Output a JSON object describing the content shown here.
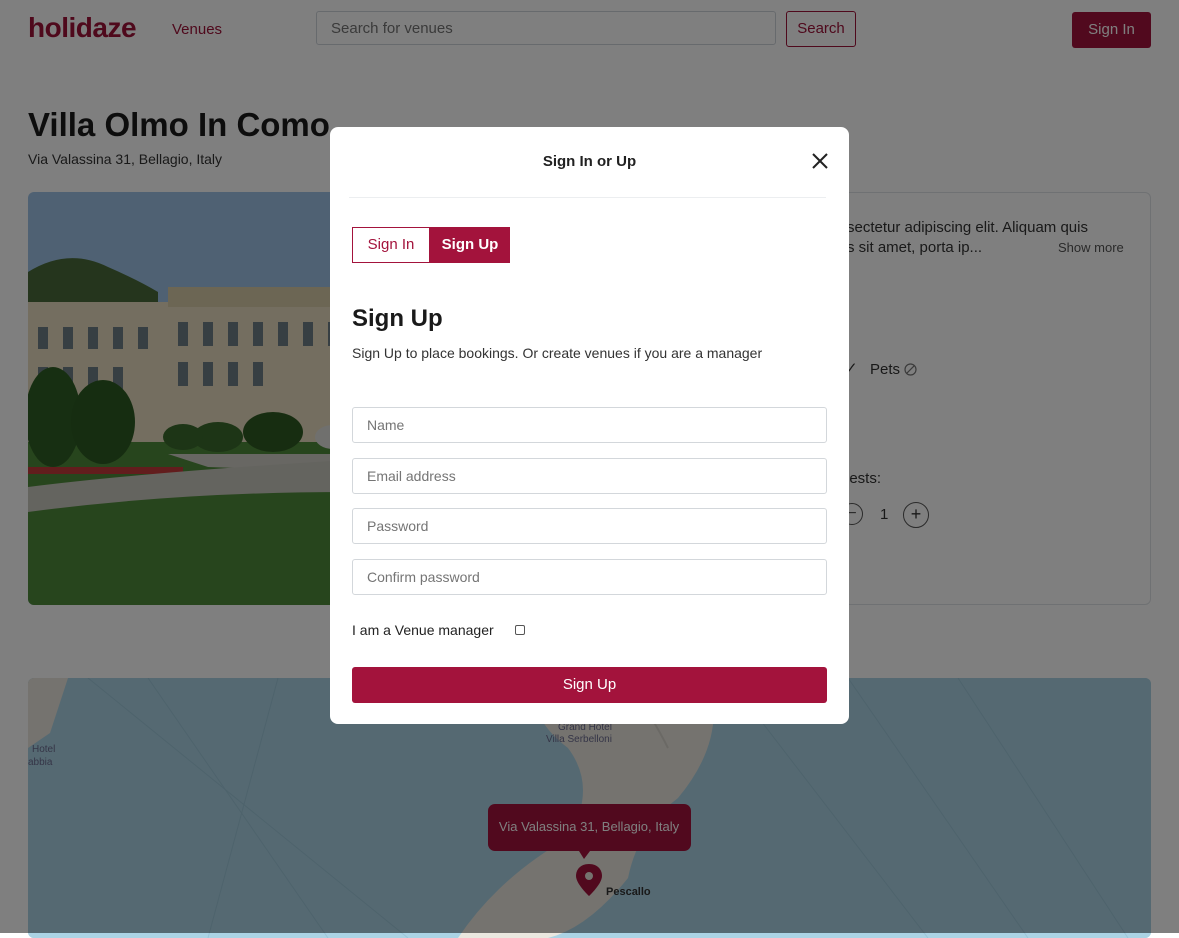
{
  "header": {
    "logo": "holidaze",
    "nav_venues": "Venues",
    "search_placeholder": "Search for venues",
    "search_button": "Search",
    "signin_button": "Sign In"
  },
  "venue": {
    "title": "Villa Olmo In Como",
    "address": "Via Valassina 31, Bellagio, Italy",
    "description_line1": "sectetur adipiscing elit. Aliquam quis",
    "description_line2": "s sit amet, porta ip...",
    "show_more": "Show more",
    "pets_label": "Pets",
    "guests_label": "uests:",
    "guest_count": "1",
    "minus": "−",
    "plus": "+"
  },
  "map": {
    "marker_address": "Via Valassina 31, Bellagio, Italy",
    "place_pescallo": "Pescallo",
    "place_grand_hotel": "Grand Hotel",
    "place_villa_serbelloni": "Villa Serbelloni",
    "place_hotel": "Hotel",
    "place_abbia": "abbia"
  },
  "modal": {
    "title": "Sign In or Up",
    "tab_signin": "Sign In",
    "tab_signup": "Sign Up",
    "form_title": "Sign Up",
    "form_subtitle": "Sign Up to place bookings. Or create venues if you are a manager",
    "name_placeholder": "Name",
    "email_placeholder": "Email address",
    "password_placeholder": "Password",
    "confirm_placeholder": "Confirm password",
    "manager_label": "I am a Venue manager",
    "submit_label": "Sign Up"
  },
  "colors": {
    "brand": "#a3133c",
    "overlay": "rgba(0,0,0,0.5)"
  }
}
